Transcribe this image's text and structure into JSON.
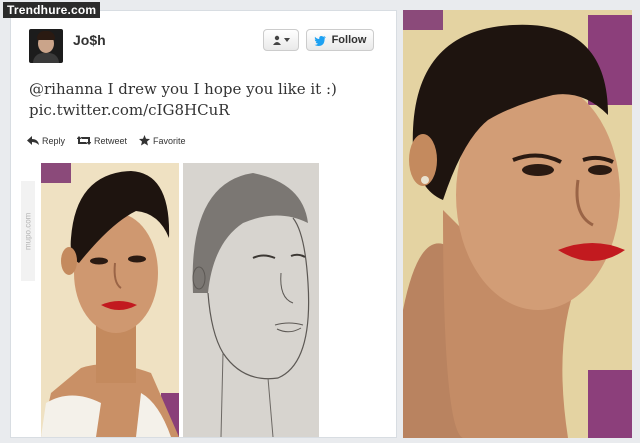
{
  "watermark": "Trendhure.com",
  "tweet": {
    "username": "Jo$h",
    "text_line1": "@rihanna I drew you I hope you like it :)",
    "link": "pic.twitter.com/cIG8HCuR",
    "actions": {
      "reply": "Reply",
      "retweet": "Retweet",
      "favorite": "Favorite"
    },
    "follow_label": "Follow",
    "user_menu_icon": "person-icon"
  },
  "side_watermark": "mupo.com",
  "colors": {
    "card_bg": "#ffffff",
    "page_bg": "#e9ebee",
    "twitter_blue": "#1da1f2",
    "lip_red": "#c21a1f"
  },
  "images": {
    "photo_original": "rihanna-photo",
    "sketch": "pencil-drawing",
    "photo_edited": "distorted-photo"
  }
}
